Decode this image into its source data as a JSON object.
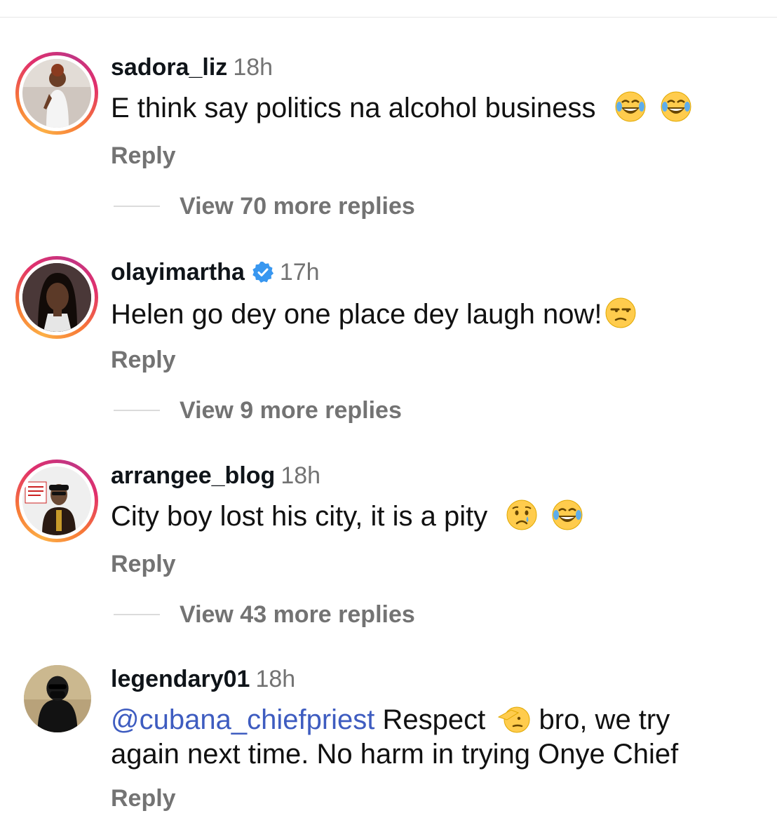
{
  "comments": [
    {
      "username": "sadora_liz",
      "time": "18h",
      "verified": false,
      "text": "E think say politics na alcohol business",
      "emojis": [
        "joy-emoji",
        "joy-emoji"
      ],
      "reply_label": "Reply",
      "more_replies": "View 70 more replies"
    },
    {
      "username": "olayimartha",
      "time": "17h",
      "verified": true,
      "text": "Helen go dey one place dey laugh now!",
      "emojis": [
        "unamused-emoji"
      ],
      "reply_label": "Reply",
      "more_replies": "View 9 more replies"
    },
    {
      "username": "arrangee_blog",
      "time": "18h",
      "verified": false,
      "text": "City boy lost his city, it is a pity",
      "emojis": [
        "crying-emoji",
        "joy-emoji"
      ],
      "reply_label": "Reply",
      "more_replies": "View 43 more replies"
    },
    {
      "username": "legendary01",
      "time": "18h",
      "verified": false,
      "mention": "@cubana_chiefpriest",
      "text_part1": "Respect",
      "emoji": "saluting-emoji",
      "text_part2": "bro, we try",
      "text_line2": "again next time. No harm in trying Onye Chief",
      "reply_label": "Reply"
    }
  ],
  "colors": {
    "accent_mention": "#3e5cc0",
    "secondary_text": "#737373",
    "verified_badge": "#3897f0"
  }
}
